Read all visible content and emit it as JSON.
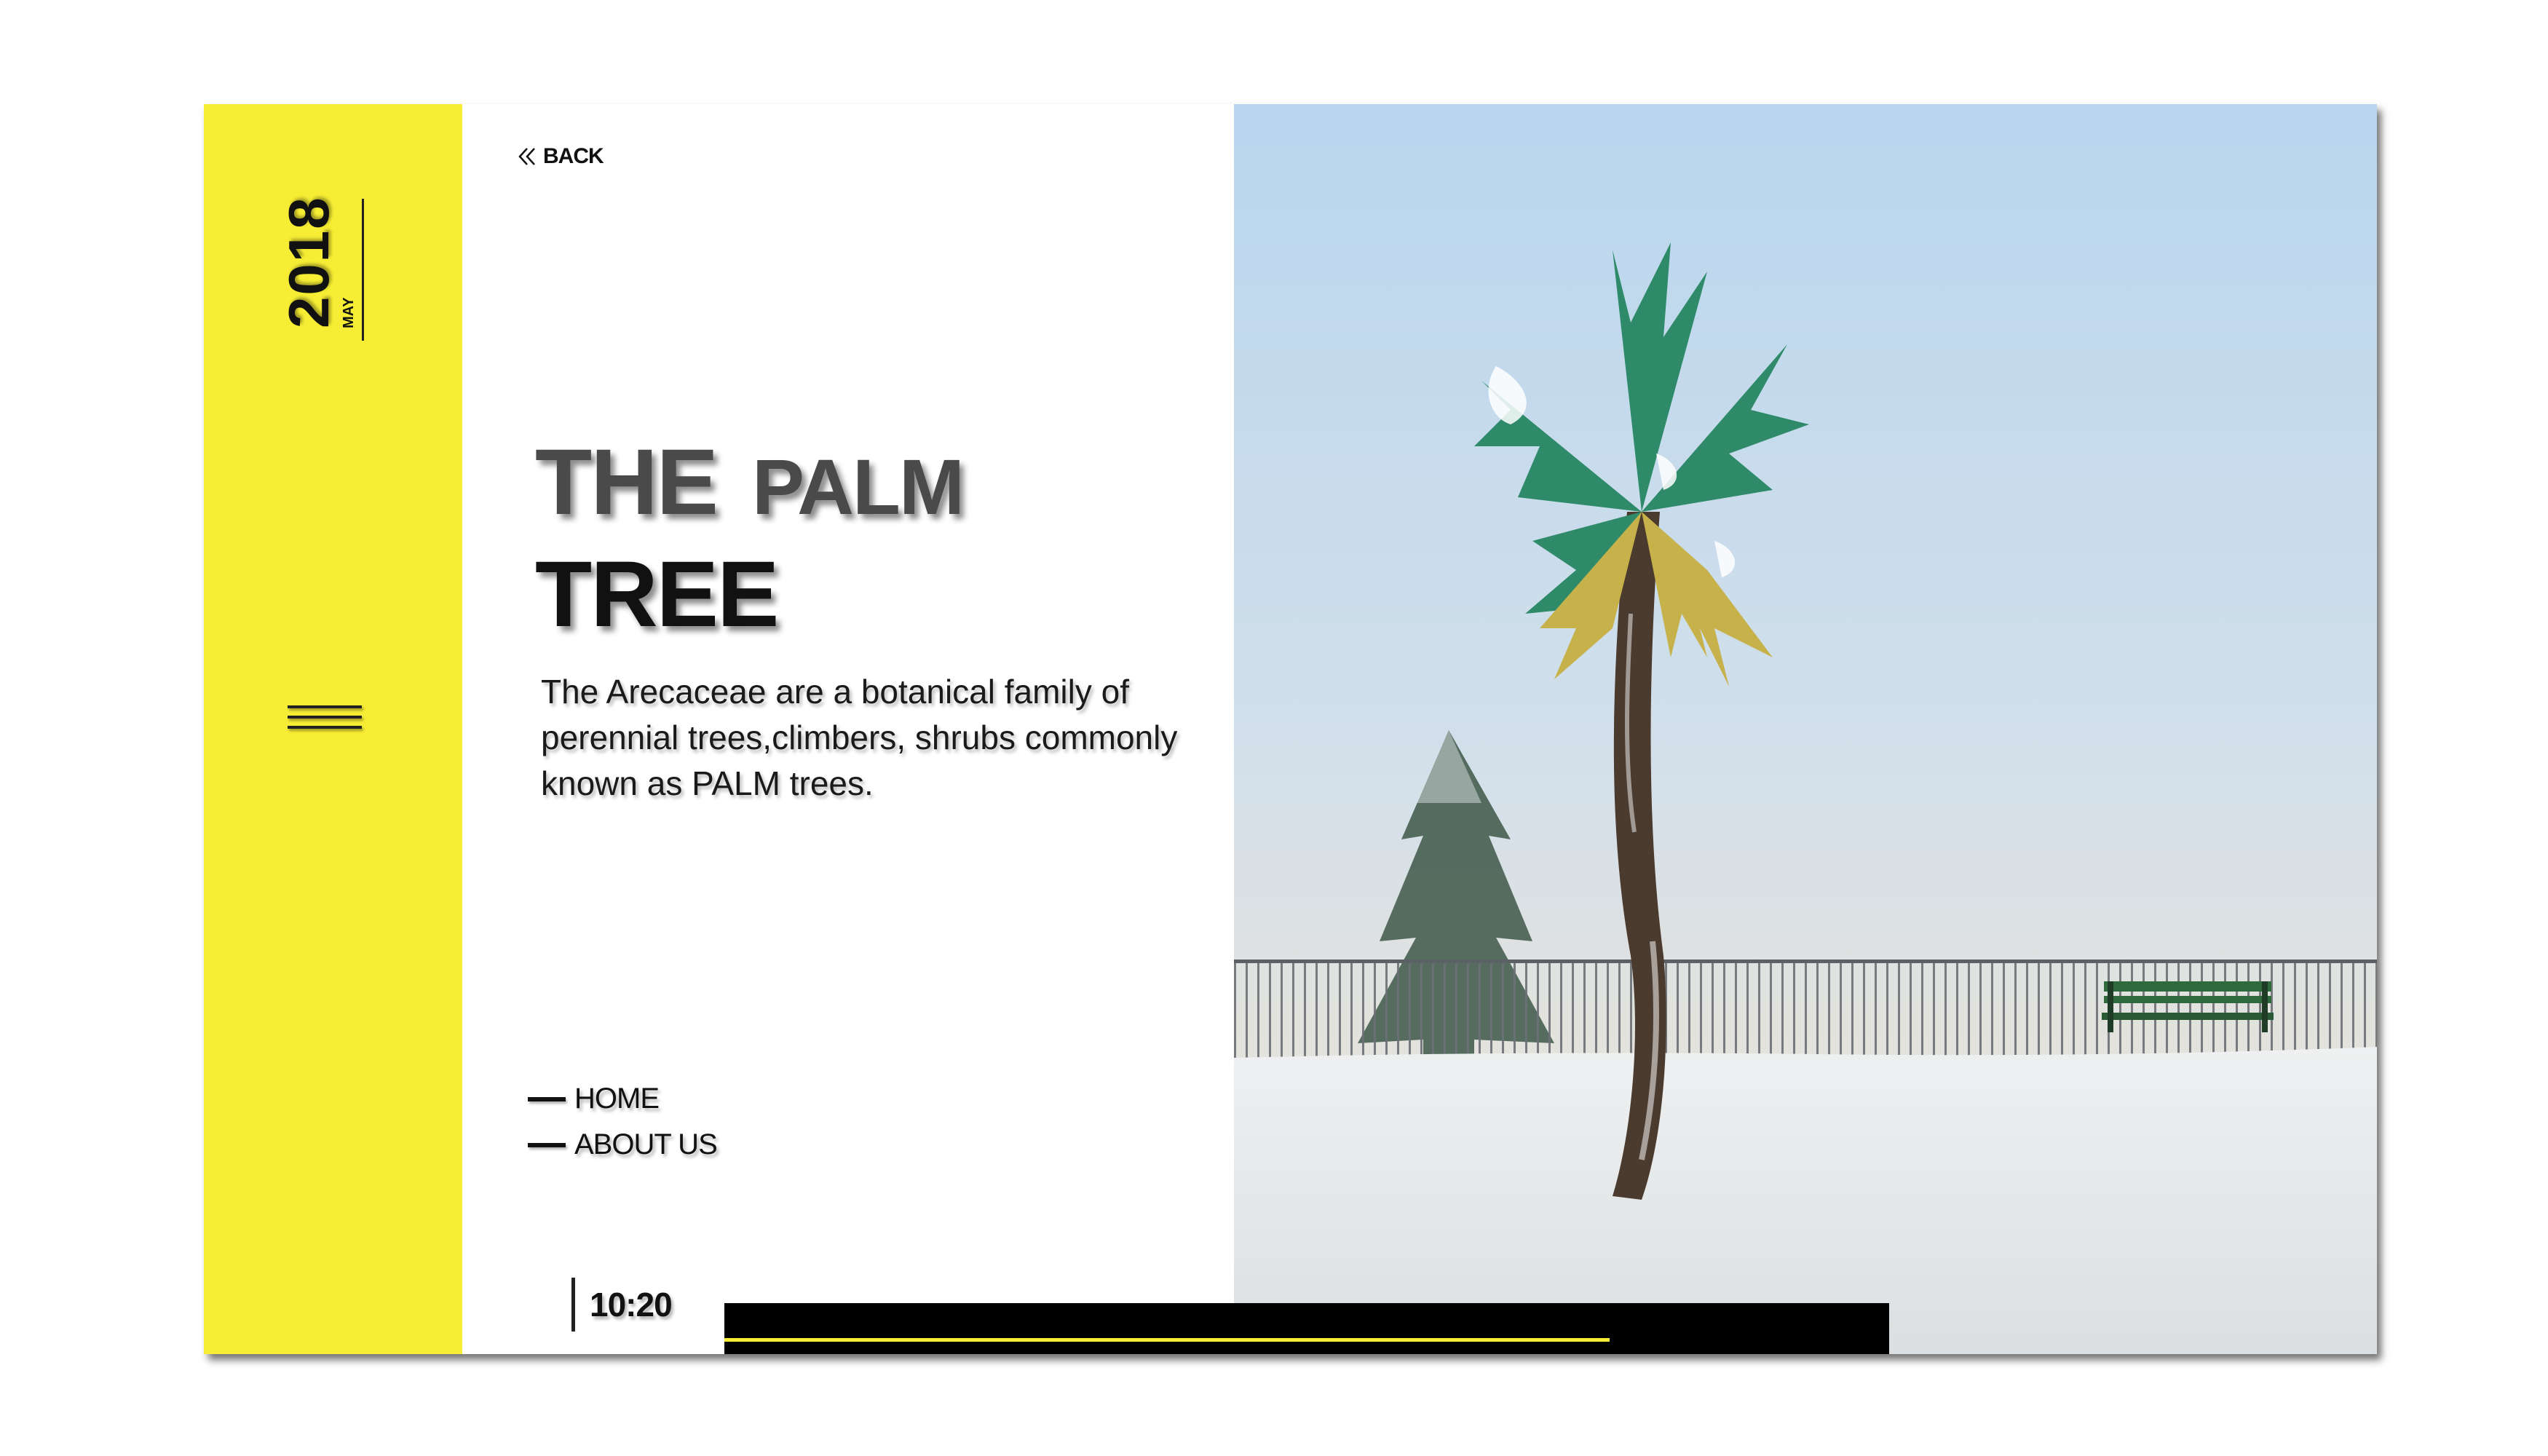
{
  "sidebar": {
    "year": "2018",
    "month": "MAY",
    "accent_color": "#f6ed34",
    "menu_icon": "hamburger-menu-icon"
  },
  "header": {
    "back_label": "BACK",
    "back_icon": "double-chevron-left-icon"
  },
  "hero": {
    "title_word_1": "THE",
    "title_word_2": "PALM",
    "title_line_2": "TREE",
    "description": "The  Arecaceae are  a botanical  family  of perennial trees,climbers, shrubs commonly known as PALM trees."
  },
  "nav": {
    "items": [
      {
        "label": "HOME"
      },
      {
        "label": "ABOUT US"
      }
    ]
  },
  "footer": {
    "time": "10:20",
    "progress": 0.76
  },
  "photo": {
    "subject": "palm-tree-in-snow-image"
  }
}
